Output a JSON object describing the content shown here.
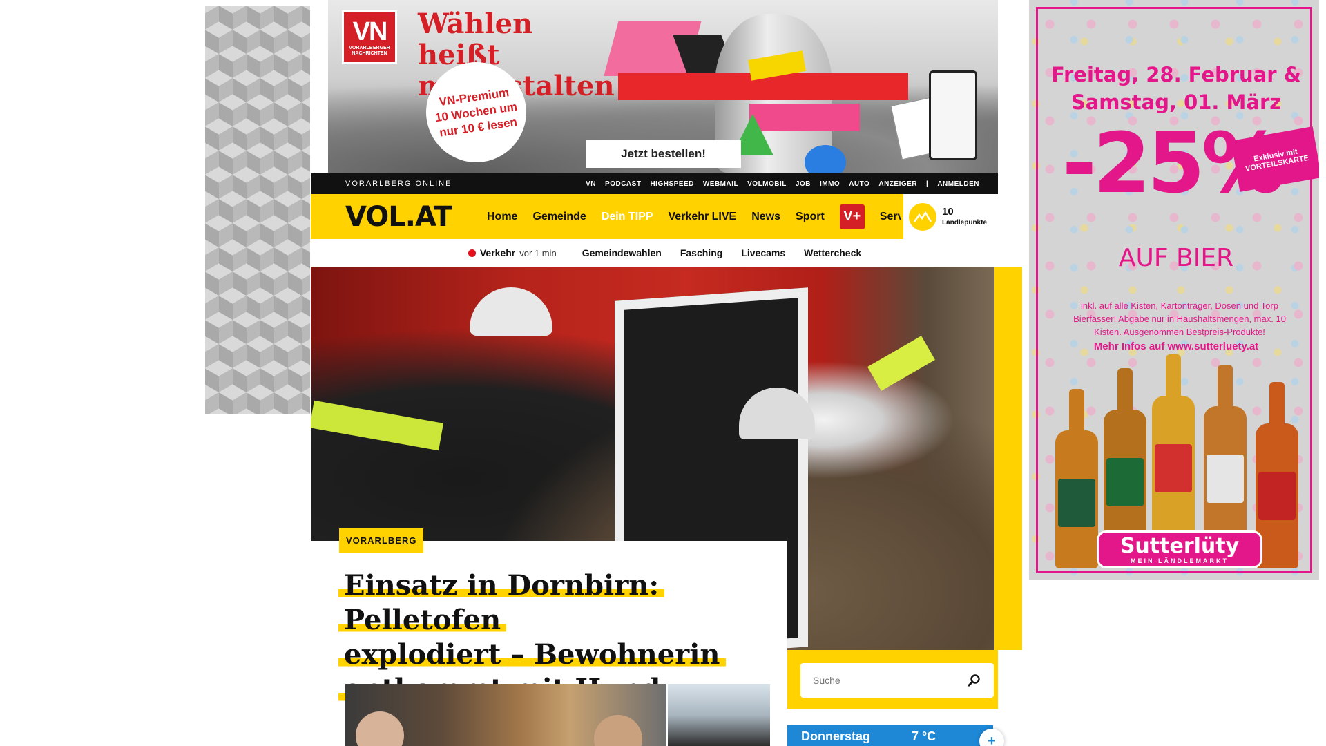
{
  "top_banner": {
    "logo_text": "VN",
    "logo_subtext": "VORARLBERGER NACHRICHTEN",
    "headline": "Wählen heißt mitgestalten",
    "premium_offer": "VN-Premium 10 Wochen um nur 10 € lesen",
    "cta_label": "Jetzt bestellen!"
  },
  "topbar": {
    "site_label": "VORARLBERG ONLINE",
    "links": [
      "VN",
      "PODCAST",
      "HIGHSPEED",
      "WEBMAIL",
      "VOLMOBIL",
      "JOB",
      "IMMO",
      "AUTO",
      "ANZEIGER",
      "|",
      "ANMELDEN"
    ]
  },
  "mainnav": {
    "logo": "VOL.AT",
    "items": [
      {
        "label": "Home",
        "highlight": false
      },
      {
        "label": "Gemeinde",
        "highlight": false
      },
      {
        "label": "Dein TIPP",
        "highlight": true
      },
      {
        "label": "Verkehr LIVE",
        "highlight": false
      },
      {
        "label": "News",
        "highlight": false
      },
      {
        "label": "Sport",
        "highlight": false
      }
    ],
    "vplus_label": "V+",
    "service_label": "Service",
    "points": {
      "value": "10",
      "label": "Ländlepunkte"
    }
  },
  "subnav": {
    "traffic_label": "Verkehr",
    "traffic_time": "vor 1 min",
    "links": [
      "Gemeindewahlen",
      "Fasching",
      "Livecams",
      "Wettercheck"
    ]
  },
  "article": {
    "tag": "VORARLBERG",
    "headline_lines": [
      "Einsatz in Dornbirn: Pelletofen",
      "explodiert – Bewohnerin",
      "entkommt mit Hund"
    ]
  },
  "search": {
    "placeholder": "Suche"
  },
  "weather": {
    "day": "Donnerstag",
    "temp": "7 °C"
  },
  "right_ad": {
    "date_line1": "Freitag, 28. Februar &",
    "date_line2": "Samstag, 01. März",
    "discount": "-25%",
    "badge": "Exklusiv mit VORTEILSKARTE",
    "product": "AUF BIER",
    "fine_print": "inkl. auf alle Kisten, Kartonträger, Dosen und Torp Bierfässer! Abgabe nur in Haushaltsmengen, max. 10 Kisten. Ausgenommen Bestpreis-Produkte!",
    "more_info": "Mehr Infos auf www.sutterluety.at",
    "brand": "Sutterlüty",
    "brand_tagline": "MEIN LÄNDLEMARKT"
  },
  "colors": {
    "brand_yellow": "#ffd200",
    "topbar_black": "#111111",
    "vn_red": "#d51f26",
    "ad_pink": "#e3178a",
    "weather_blue": "#1e88d6"
  }
}
